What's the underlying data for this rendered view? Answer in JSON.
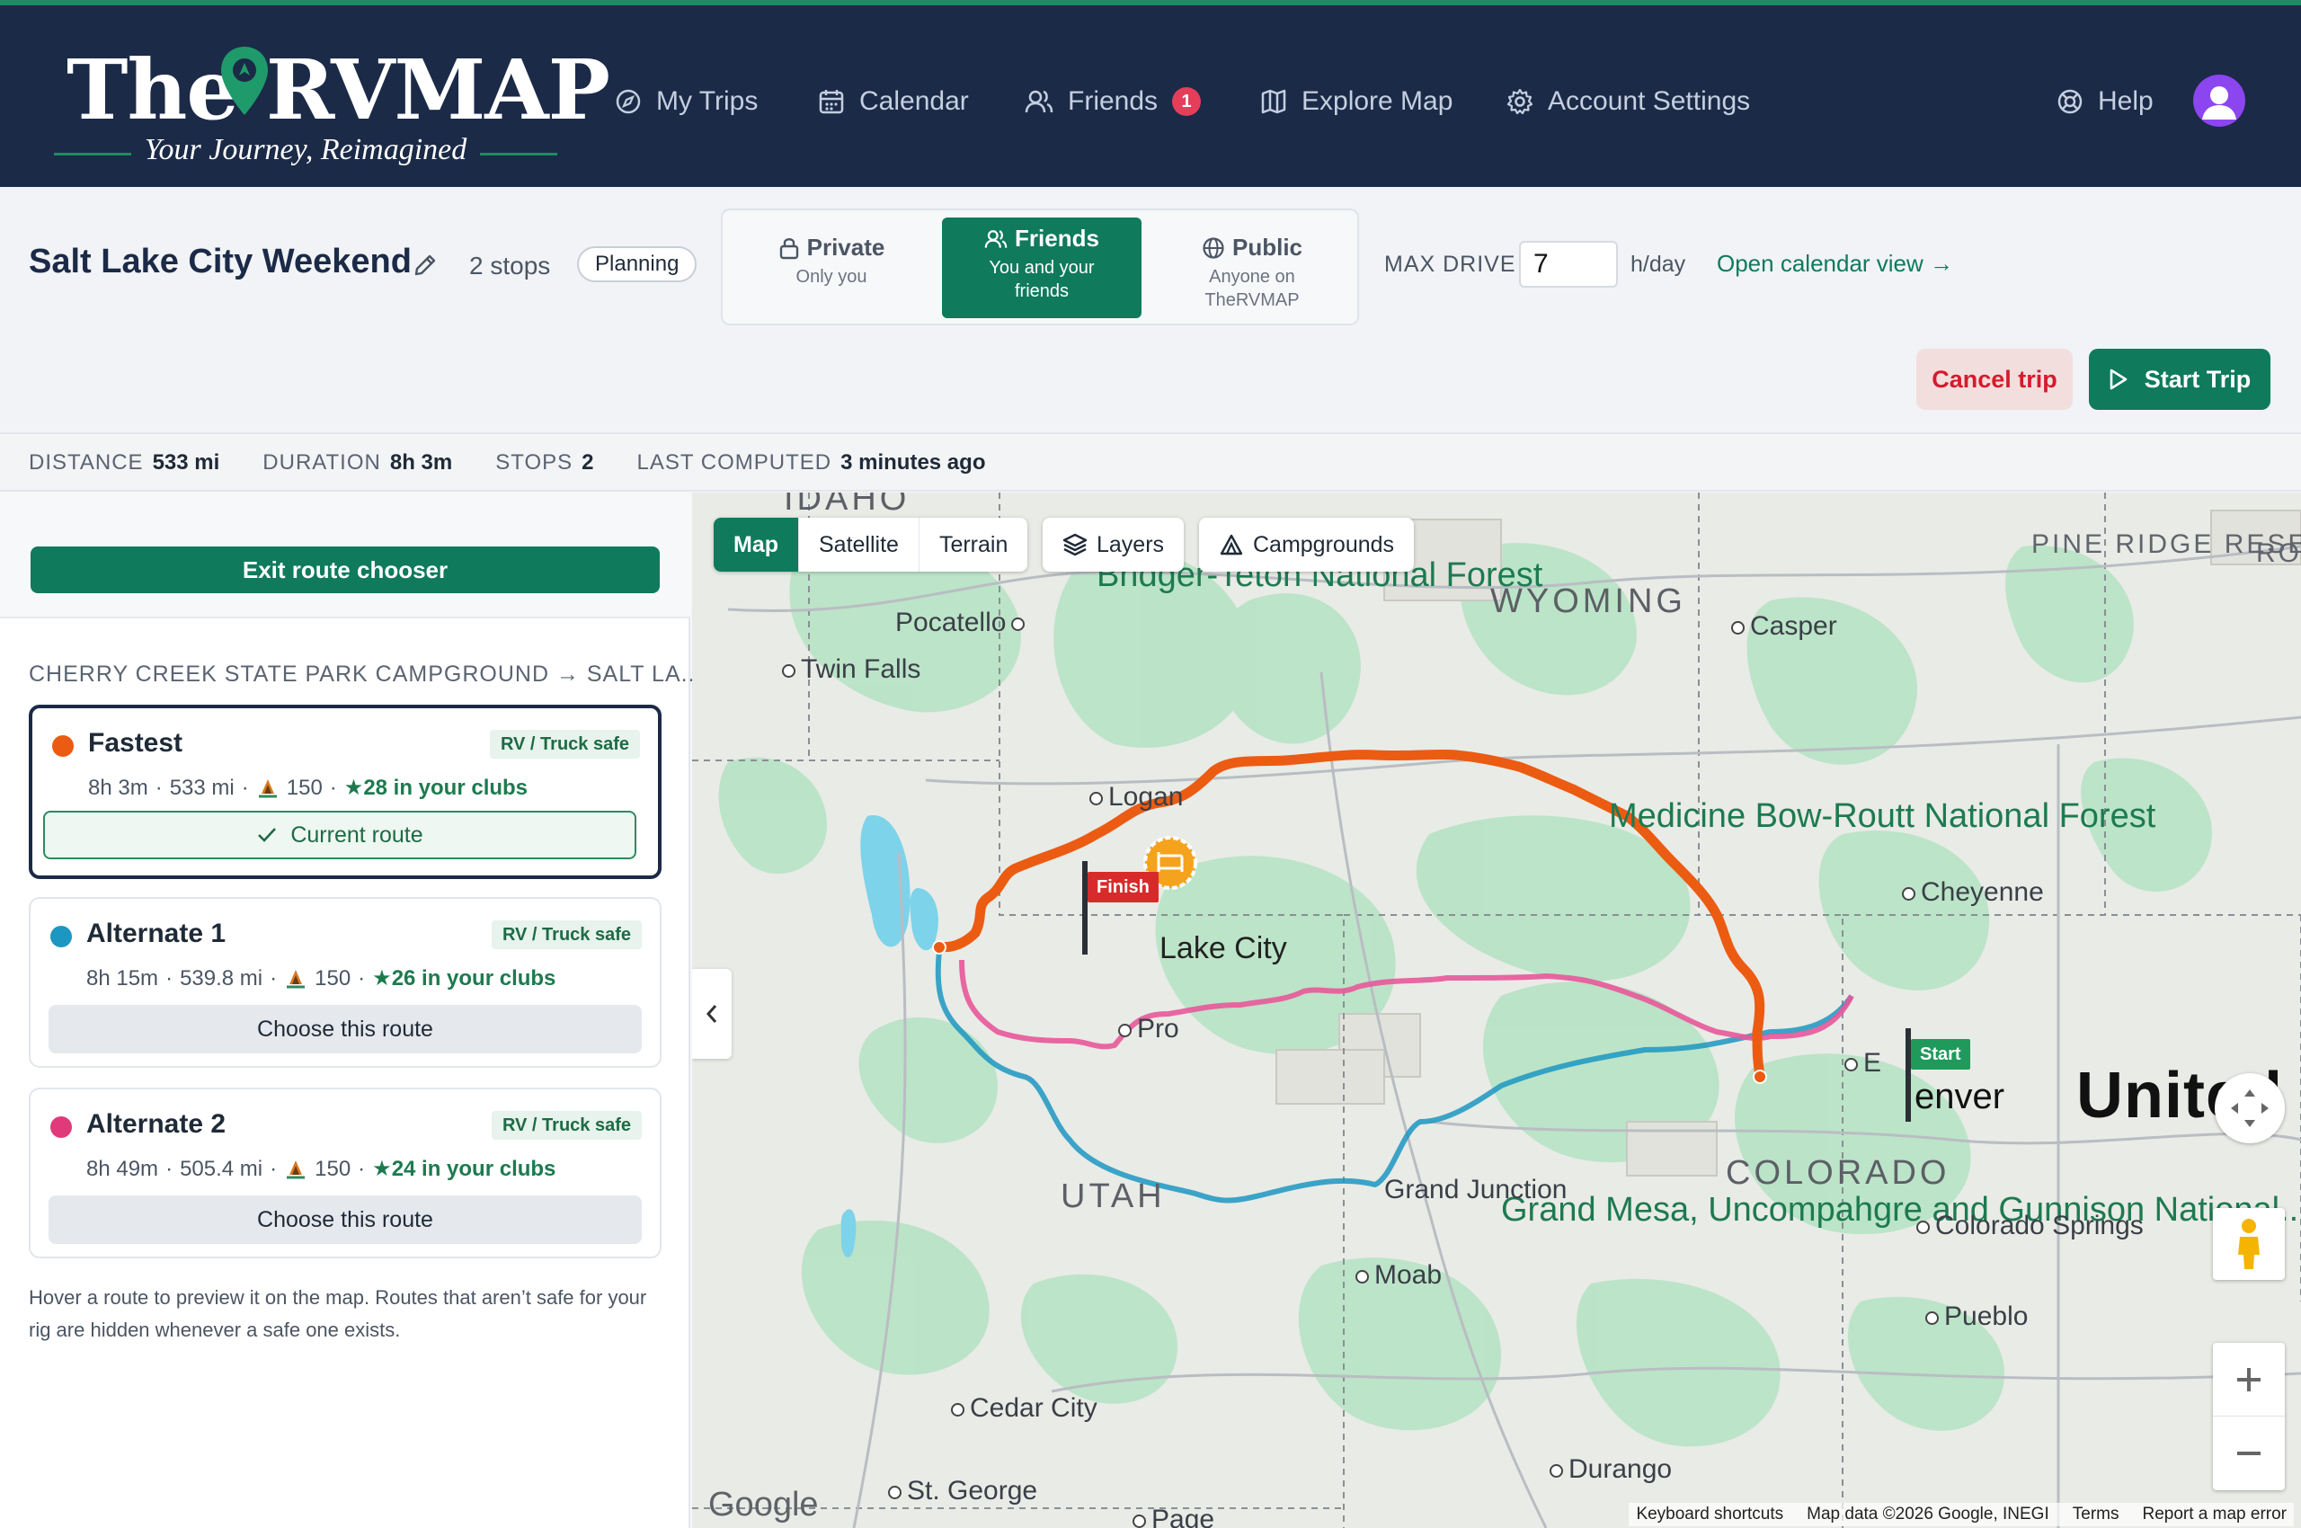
{
  "header": {
    "logo_main": "The RVMAP",
    "logo_tagline": "Your Journey, Reimagined",
    "nav": [
      {
        "label": "My Trips",
        "icon": "compass-icon"
      },
      {
        "label": "Calendar",
        "icon": "calendar-icon"
      },
      {
        "label": "Friends",
        "icon": "users-icon",
        "badge": "1"
      },
      {
        "label": "Explore Map",
        "icon": "map-icon"
      },
      {
        "label": "Account Settings",
        "icon": "gear-icon"
      }
    ],
    "help_label": "Help",
    "brand_color": "#1b2a47",
    "accent_color": "#0f7a5c"
  },
  "trip": {
    "title": "Salt Lake City Weekend",
    "stops_label": "2 stops",
    "status": "Planning",
    "visibility": {
      "options": [
        {
          "title": "Private",
          "sub": "Only you",
          "icon": "lock-icon"
        },
        {
          "title": "Friends",
          "sub": "You and your friends",
          "icon": "users-icon"
        },
        {
          "title": "Public",
          "sub": "Anyone on TheRVMAP",
          "icon": "globe-icon"
        }
      ],
      "selected": "Friends"
    },
    "max_drive_label": "MAX DRIVE",
    "max_drive_value": "7",
    "max_drive_unit": "h/day",
    "calendar_link": "Open calendar view →",
    "cancel_label": "Cancel trip",
    "start_label": "Start Trip"
  },
  "stats": [
    {
      "label": "DISTANCE",
      "value": "533 mi"
    },
    {
      "label": "DURATION",
      "value": "8h 3m"
    },
    {
      "label": "STOPS",
      "value": "2"
    },
    {
      "label": "LAST COMPUTED",
      "value": "3 minutes ago"
    }
  ],
  "route_chooser": {
    "exit_label": "Exit route chooser",
    "heading": "CHERRY CREEK STATE PARK CAMPGROUND → SALT LA...",
    "routes": [
      {
        "name": "Fastest",
        "color": "#ec5b12",
        "safe": "RV / Truck safe",
        "time": "8h 3m",
        "distance": "533 mi",
        "campgrounds": "150",
        "clubs": "★28 in your clubs",
        "button": "Current route",
        "selected": true
      },
      {
        "name": "Alternate 1",
        "color": "#1c97c1",
        "safe": "RV / Truck safe",
        "time": "8h 15m",
        "distance": "539.8 mi",
        "campgrounds": "150",
        "clubs": "★26 in your clubs",
        "button": "Choose this route",
        "selected": false
      },
      {
        "name": "Alternate 2",
        "color": "#e03a7a",
        "safe": "RV / Truck safe",
        "time": "8h 49m",
        "distance": "505.4 mi",
        "campgrounds": "150",
        "clubs": "★24 in your clubs",
        "button": "Choose this route",
        "selected": false
      }
    ],
    "hint": "Hover a route to preview it on the map. Routes that aren’t safe for your rig are hidden whenever a safe one exists."
  },
  "map": {
    "types": [
      "Map",
      "Satellite",
      "Terrain"
    ],
    "active_type": "Map",
    "layers_label": "Layers",
    "campgrounds_label": "Campgrounds",
    "flag_finish": "Finish",
    "flag_start": "Start",
    "labels": {
      "idaho": "IDAHO",
      "wyoming": "WYOMING",
      "utah": "UTAH",
      "colorado": "COLORADO",
      "pocatello": "Pocatello",
      "twin_falls": "Twin Falls",
      "casper": "Casper",
      "logan": "Logan",
      "cheyenne": "Cheyenne",
      "slc": "Lake City",
      "provo": "Pro",
      "denver": "enver",
      "boulder": "E",
      "grand_junction": "Grand Junction",
      "moab": "Moab",
      "colorado_springs": "Colorado Springs",
      "pueblo": "Pueblo",
      "cedar_city": "Cedar City",
      "st_george": "St. George",
      "durango": "Durango",
      "page": "Page",
      "bridger": "Bridger-Teton National Forest",
      "medicine_bow": "Medicine Bow-Routt National Forest",
      "grand_mesa": "Grand Mesa, Uncompahgre and Gunnison National...",
      "pine_ridge": "PINE RIDGE RESERVATION",
      "united": "United",
      "ro": "RO"
    },
    "google": "Google",
    "attribution": [
      "Keyboard shortcuts",
      "Map data ©2026 Google, INEGI",
      "Terms",
      "Report a map error"
    ]
  }
}
